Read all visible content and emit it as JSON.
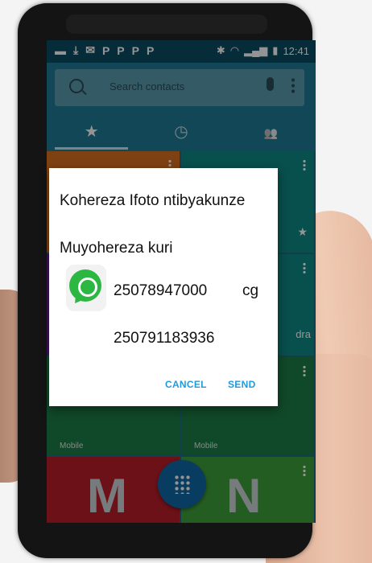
{
  "status_bar": {
    "left_icons": [
      "messages-icon",
      "download-icon",
      "mail-icon",
      "p-icon",
      "p-icon",
      "p-icon",
      "p-icon"
    ],
    "p_label": "P",
    "time": "12:41"
  },
  "search": {
    "placeholder": "Search contacts"
  },
  "tabs": [
    {
      "icon": "star-icon",
      "glyph": "★"
    },
    {
      "icon": "clock-icon",
      "glyph": "◷"
    },
    {
      "icon": "people-icon",
      "glyph": "👥"
    }
  ],
  "tiles": {
    "tile_1_letter": "M",
    "tile_3_letter": "M",
    "tile_4_snippet": "dra",
    "meta_mobile": "Mobile"
  },
  "big_letters": [
    "M",
    "N"
  ],
  "dialog": {
    "title": "Kohereza Ifoto ntibyakunze",
    "subtitle": "Muyohereza kuri",
    "number_1": "25078947000",
    "number_1_suffix": "cg",
    "number_2": "250791183936",
    "cancel_label": "CANCEL",
    "send_label": "SEND"
  },
  "colors": {
    "tile_orange": "#d9711f",
    "tile_teal": "#0f8b86",
    "tile_purple": "#6b1e9b",
    "tile_green": "#1d7f47",
    "tile_red": "#b81e29",
    "tile_lime": "#3fa03a",
    "accent": "#1d9be0"
  }
}
